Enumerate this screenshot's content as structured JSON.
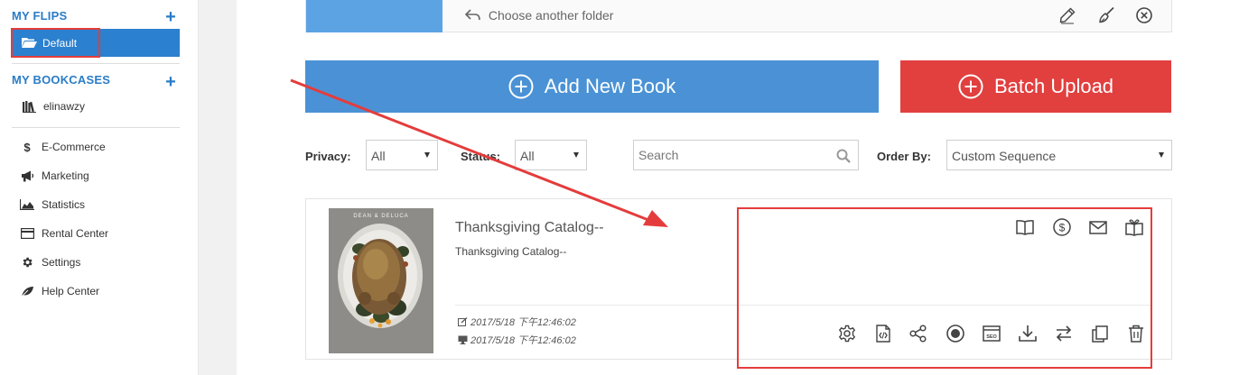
{
  "sidebar": {
    "my_flips_heading": "MY FLIPS",
    "my_flips_add": "+",
    "default_folder": "Default",
    "my_bookcases_heading": "MY BOOKCASES",
    "my_bookcases_add": "+",
    "bookcase_item": "elinawzy",
    "menu": [
      {
        "label": "E-Commerce",
        "icon": "dollar-icon"
      },
      {
        "label": "Marketing",
        "icon": "megaphone-icon"
      },
      {
        "label": "Statistics",
        "icon": "area-chart-icon"
      },
      {
        "label": "Rental Center",
        "icon": "card-icon"
      },
      {
        "label": "Settings",
        "icon": "gear-icon"
      },
      {
        "label": "Help Center",
        "icon": "leaf-icon"
      }
    ]
  },
  "folder_bar": {
    "choose_label": "Choose another folder",
    "swatch_color": "#5ba3e3"
  },
  "buttons": {
    "add_new_book": "Add New Book",
    "batch_upload": "Batch Upload",
    "add_color": "#4a92d5",
    "batch_color": "#e23f3f"
  },
  "filters": {
    "privacy_label": "Privacy:",
    "privacy_value": "All",
    "status_label": "Status:",
    "status_value": "All",
    "search_placeholder": "Search",
    "order_label": "Order By:",
    "order_value": "Custom Sequence"
  },
  "book": {
    "cover_brand": "DEAN & DELUCA",
    "title": "Thanksgiving Catalog--",
    "subtitle": "Thanksgiving Catalog--",
    "modified": "2017/5/18 下午12:46:02",
    "published": "2017/5/18 下午12:46:02",
    "top_actions": [
      "book-open-icon",
      "dollar-circle-icon",
      "mail-icon",
      "gift-book-icon"
    ],
    "bottom_actions": [
      "gear-icon",
      "code-file-icon",
      "share-icon",
      "stop-circle-icon",
      "seo-icon",
      "download-icon",
      "swap-icon",
      "copy-icon",
      "trash-icon"
    ]
  },
  "annotation_color": "#e43c3c"
}
